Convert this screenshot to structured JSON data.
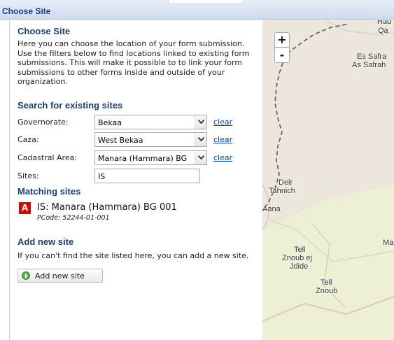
{
  "window": {
    "title": "Choose Site"
  },
  "panel": {
    "heading": "Choose Site",
    "intro": "Here you can choose the location of your form submission. Use the filters below to find locations linked to existing form submissions. This will make it possible to to link your form submissions to other forms inside and outside of your organization.",
    "search_heading": "Search for existing sites",
    "filters": [
      {
        "label": "Governorate:",
        "value": "Bekaa",
        "clear": "clear"
      },
      {
        "label": "Caza:",
        "value": "West Bekaa",
        "clear": "clear"
      },
      {
        "label": "Cadastral Area:",
        "value": "Manara (Hammara) BG",
        "clear": "clear"
      }
    ],
    "sites": {
      "label": "Sites:",
      "value": "IS"
    },
    "matching_heading": "Matching sites",
    "matches": [
      {
        "badge": "A",
        "name": "IS: Manara (Hammara) BG 001",
        "pcode": "PCode: 52244-01-001"
      }
    ],
    "add_heading": "Add new site",
    "add_text": "If you can't find the site listed here, you can add a new site.",
    "add_button": "Add new site"
  },
  "map": {
    "zoom_in": "+",
    "zoom_out": "-",
    "labels": {
      "top_right": "Qa",
      "top_edge": "Had",
      "es_safra_1": "Es Safra",
      "es_safra_2": "As Safrah",
      "deir_1": "Deir",
      "deir_2": "Tahnich",
      "aana": "Aana",
      "ma": "Ma",
      "tell_1": "Tell",
      "tell_2": "Znoub ej",
      "tell_3": "Jdide",
      "tell_znoub_1": "Tell",
      "tell_znoub_2": "Znoub"
    },
    "colors": {
      "land": "#ece6dc",
      "farmland": "#eef0d6",
      "border": "#666666",
      "road": "#c9bfb2"
    }
  }
}
